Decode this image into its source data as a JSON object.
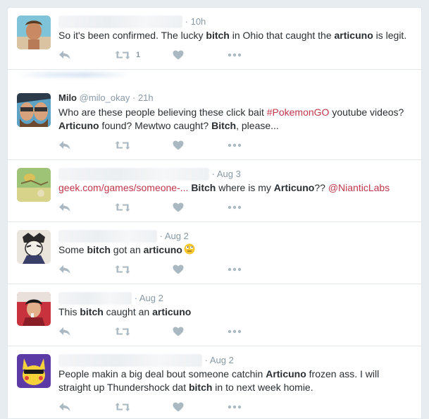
{
  "colors": {
    "background": "#e6ecf0",
    "text": "#292f33",
    "muted": "#8899a6",
    "icon": "#aab8c2",
    "link": "#c0364b"
  },
  "tweets": [
    {
      "time": "10h",
      "text": [
        "So it's been confirmed. The lucky ",
        "bitch",
        " in Ohio that caught the ",
        "articuno",
        " is legit."
      ],
      "retweet_count": "1"
    },
    {
      "name": "Milo",
      "handle": "@milo_okay",
      "time": "21h",
      "line1": [
        "Who are these people believing these click bait ",
        "#PokemonGO",
        " youtube videos?"
      ],
      "line2": [
        "Articuno",
        " found? Mewtwo caught? ",
        "Bitch",
        ", please..."
      ]
    },
    {
      "time": "Aug 3",
      "text": [
        "geek.com/games/someone-...",
        " ",
        "Bitch",
        " where is my ",
        "Articuno",
        "?? ",
        "@NianticLabs"
      ]
    },
    {
      "time": "Aug 2",
      "text": [
        "Some ",
        "bitch",
        " got an ",
        "articuno"
      ]
    },
    {
      "time": "Aug 2",
      "text": [
        "This ",
        "bitch",
        " caught an ",
        "articuno"
      ]
    },
    {
      "time": "Aug 2",
      "line1": [
        "People makin a big deal bout someone catchin ",
        "Articuno",
        " frozen ass. I will"
      ],
      "line2": [
        "straight up Thundershock dat ",
        "bitch",
        " in to next week homie."
      ]
    }
  ],
  "separator": "·"
}
